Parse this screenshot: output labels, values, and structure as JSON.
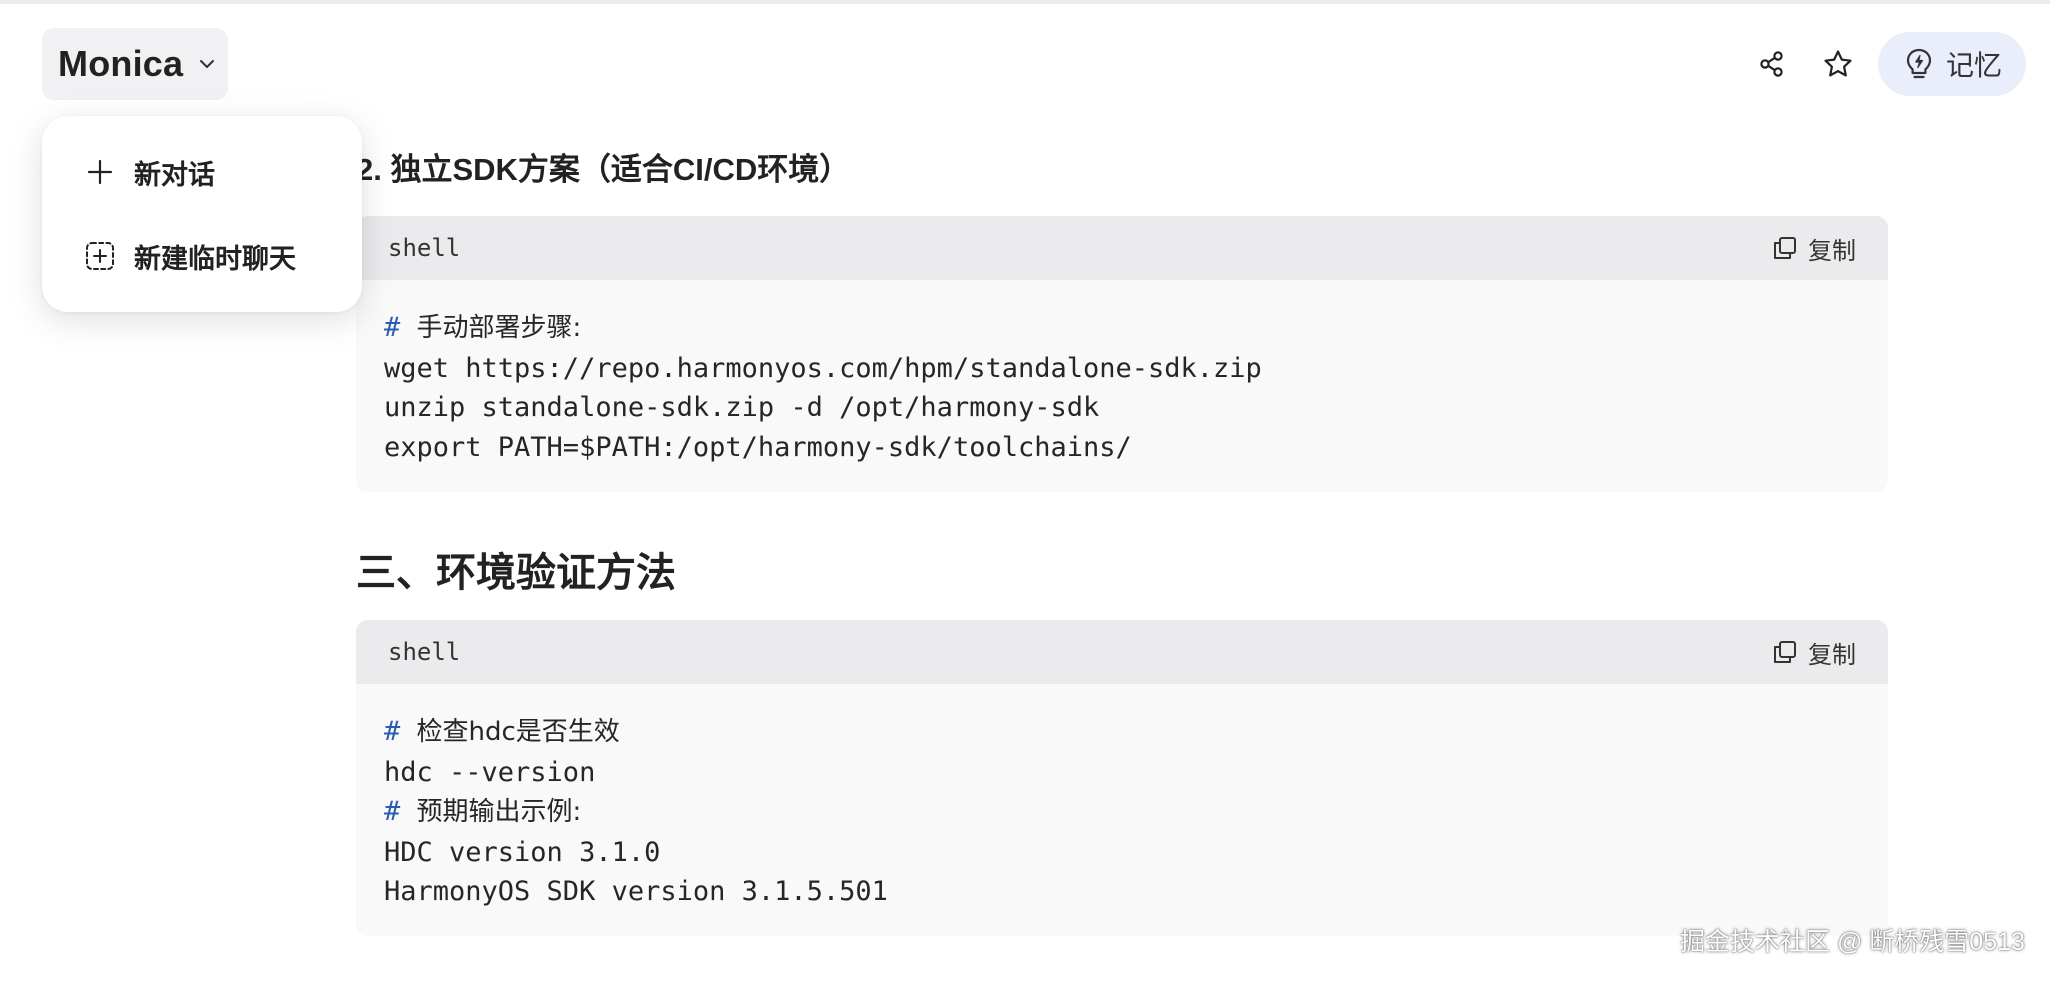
{
  "header": {
    "app_name": "Monica",
    "share_icon": "share-icon",
    "star_icon": "star-icon",
    "memory_label": "记忆",
    "memory_icon": "lightbulb-bolt-icon"
  },
  "menu": {
    "items": [
      {
        "label": "新对话",
        "icon": "plus-icon"
      },
      {
        "label": "新建临时聊天",
        "icon": "dashed-plus-icon"
      }
    ]
  },
  "content": {
    "section_heading": "2. 独立SDK方案（适合CI/CD环境）",
    "code_block_1": {
      "lang": "shell",
      "copy_label": "复制",
      "comment_hash": "#",
      "comment_text": "手动部署步骤:",
      "lines": [
        "wget https://repo.harmonyos.com/hpm/standalone-sdk.zip",
        "unzip standalone-sdk.zip -d /opt/harmony-sdk",
        "export PATH=$PATH:/opt/harmony-sdk/toolchains/"
      ]
    },
    "heading_2": "三、环境验证方法",
    "code_block_2": {
      "lang": "shell",
      "copy_label": "复制",
      "comment1_hash": "#",
      "comment1_text": "检查hdc是否生效",
      "line1": "hdc --version",
      "comment2_hash": "#",
      "comment2_text": "预期输出示例:",
      "line2": "HDC version 3.1.0",
      "line3": "HarmonyOS SDK version 3.1.5.501"
    }
  },
  "watermark": "掘金技术社区 @ 断桥残雪0513"
}
